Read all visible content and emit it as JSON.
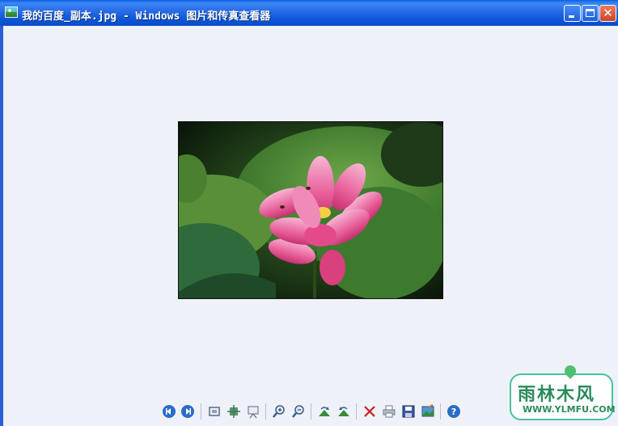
{
  "window": {
    "title": "我的百度_副本.jpg - Windows 图片和传真查看器",
    "icon": "picture-viewer-icon"
  },
  "image": {
    "subject": "pink lotus flower among green lotus leaves"
  },
  "toolbar": {
    "buttons": [
      {
        "name": "previous-image-button",
        "icon": "previous-icon"
      },
      {
        "name": "next-image-button",
        "icon": "next-icon"
      },
      {
        "name": "best-fit-button",
        "icon": "best-fit-icon"
      },
      {
        "name": "actual-size-button",
        "icon": "actual-size-icon"
      },
      {
        "name": "slideshow-button",
        "icon": "slideshow-icon"
      },
      {
        "name": "zoom-in-button",
        "icon": "zoom-in-icon"
      },
      {
        "name": "zoom-out-button",
        "icon": "zoom-out-icon"
      },
      {
        "name": "rotate-clockwise-button",
        "icon": "rotate-clockwise-icon"
      },
      {
        "name": "rotate-counterclockwise-button",
        "icon": "rotate-counterclockwise-icon"
      },
      {
        "name": "delete-button",
        "icon": "delete-icon"
      },
      {
        "name": "print-button",
        "icon": "print-icon"
      },
      {
        "name": "save-button",
        "icon": "save-icon"
      },
      {
        "name": "open-for-editing-button",
        "icon": "edit-icon"
      },
      {
        "name": "help-button",
        "icon": "help-icon"
      }
    ]
  },
  "watermark": {
    "text_cn": "雨林木风",
    "text_en": "WWW.YLMFU.COM"
  },
  "colors": {
    "titlebar": "#0c56d8",
    "client_background": "#eef2f8",
    "watermark_green": "#2a8a5a"
  }
}
